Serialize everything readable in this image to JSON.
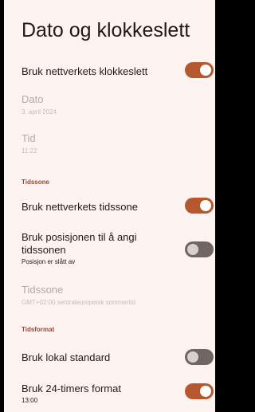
{
  "header": {
    "title": "Dato og klokkeslett"
  },
  "settings": {
    "network_time": {
      "label": "Bruk nettverkets klokkeslett",
      "enabled": true
    },
    "date": {
      "label": "Dato",
      "value": "3. april 2024"
    },
    "time": {
      "label": "Tid",
      "value": "11:22"
    },
    "timezone_section": "Tidssone",
    "network_timezone": {
      "label": "Bruk nettverkets tidssone",
      "enabled": true
    },
    "location_timezone": {
      "label": "Bruk posisjonen til å angi tidssonen",
      "summary": "Posisjon er slått av",
      "enabled": false
    },
    "timezone": {
      "label": "Tidssone",
      "value": "GMT+02:00 sentraleuropeisk sommertid"
    },
    "format_section": "Tidsformat",
    "locale_default": {
      "label": "Bruk lokal standard",
      "enabled": false
    },
    "format_24h": {
      "label": "Bruk 24-timers format",
      "summary": "13:00",
      "enabled": true
    }
  },
  "colors": {
    "background": "#FDF3F1",
    "accent": "#B5582F",
    "section_header": "#904A3C",
    "toggle_off": "#6F6563"
  }
}
